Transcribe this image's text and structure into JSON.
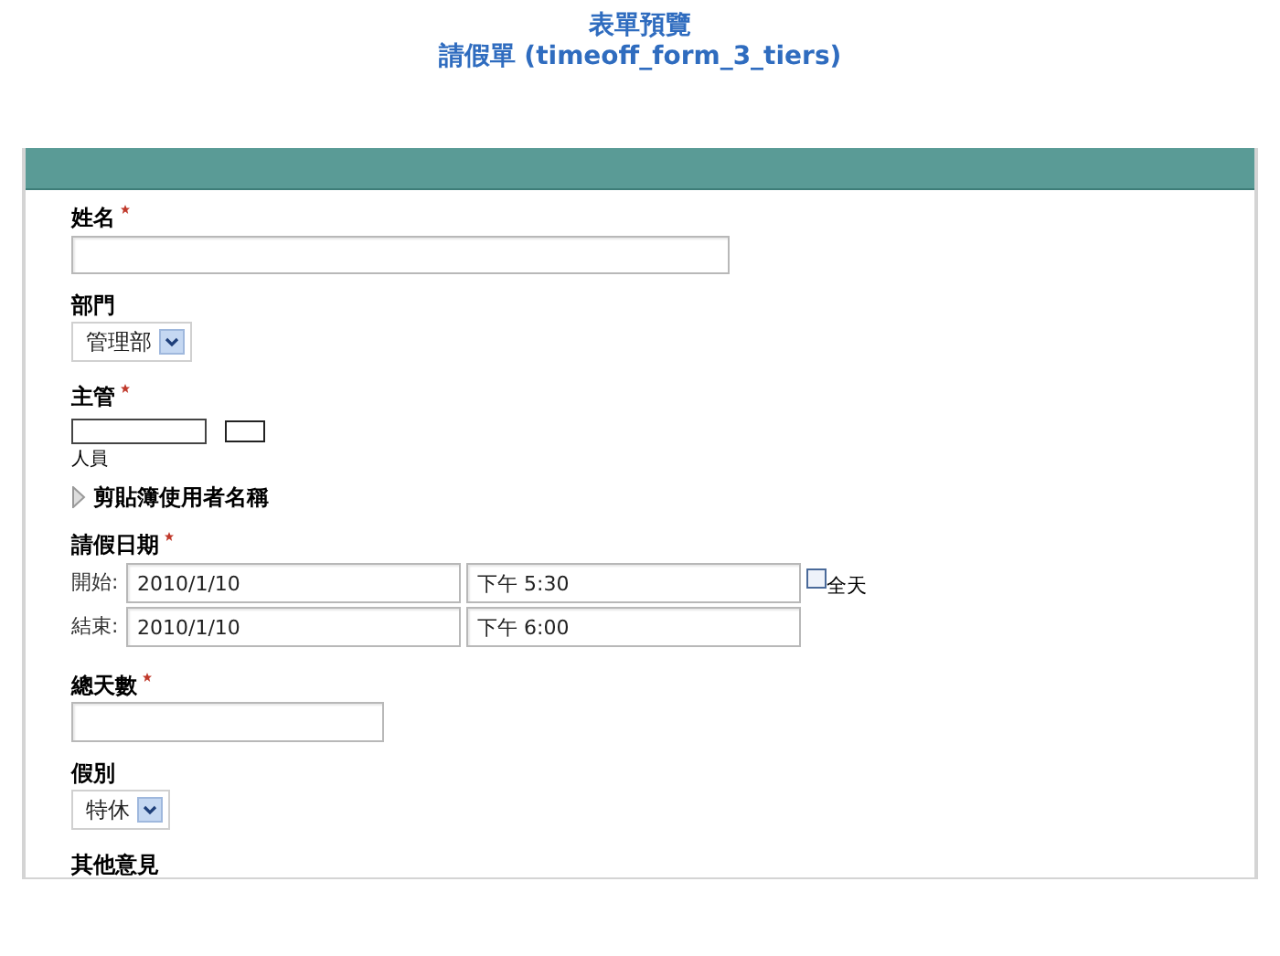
{
  "header": {
    "title": "表單預覽",
    "subtitle": "請假單 (timeoff_form_3_tiers)"
  },
  "fields": [
    {
      "kind": "long_text",
      "label": "姓名",
      "required": true
    },
    {
      "kind": "select",
      "label": "部門",
      "required": false,
      "value": "管理部"
    },
    {
      "kind": "person",
      "label": "主管",
      "required": true,
      "caption": "人員"
    },
    {
      "kind": "disclosure",
      "label": "剪貼簿使用者名稱",
      "expanded": false
    },
    {
      "kind": "daterange",
      "label": "請假日期",
      "required": true,
      "rows": [
        {
          "label": "開始:",
          "date": "2010/1/10",
          "time": "下午 5:30",
          "all_day": {
            "label": "全天",
            "checked": false
          }
        },
        {
          "label": "結束:",
          "date": "2010/1/10",
          "time": "下午 6:00"
        }
      ]
    },
    {
      "kind": "short_text",
      "label": "總天數",
      "required": true
    },
    {
      "kind": "select",
      "label": "假別",
      "required": false,
      "value": "特休"
    },
    {
      "kind": "label",
      "label": "其他意見",
      "required": false
    }
  ]
}
